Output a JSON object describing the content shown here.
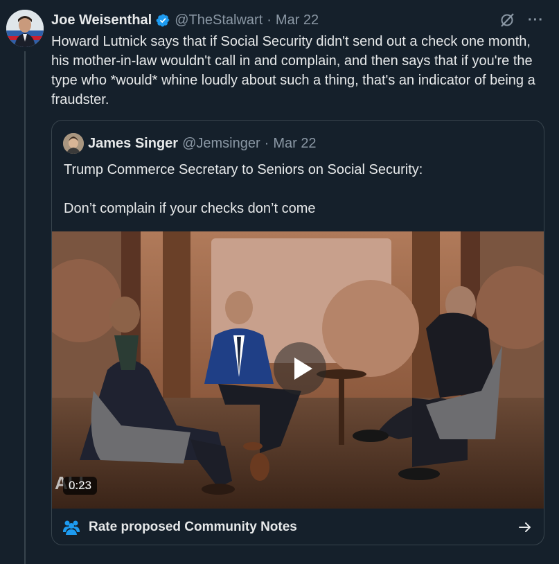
{
  "tweet": {
    "author_name": "Joe Weisenthal",
    "handle": "@TheStalwart",
    "separator": "·",
    "date": "Mar 22",
    "more_label": "···",
    "text": "Howard Lutnick says that if Social Security didn't send out a check one month, his mother-in-law wouldn't call in and complain, and then says that if you're the type who *would* whine loudly about such a thing, that's an indicator of being a fraudster."
  },
  "quote": {
    "author_name": "James Singer",
    "handle": "@Jemsinger",
    "separator": "·",
    "date": "Mar 22",
    "text_line1": "Trump Commerce Secretary to Seniors on Social Security:",
    "text_line2": "Don’t complain if your checks don’t come",
    "video": {
      "duration": "0:23"
    }
  },
  "community_notes": {
    "label": "Rate proposed Community Notes"
  },
  "colors": {
    "background": "#15202b",
    "text": "#e7e9ea",
    "muted": "#8b98a5",
    "border": "#38444d",
    "verified": "#1d9bf0",
    "notes_icon": "#1d9bf0"
  },
  "icons": {
    "verified": "verified-badge-icon",
    "grok": "grok-icon",
    "more": "more-icon",
    "play": "play-icon",
    "notes": "people-icon",
    "arrow": "arrow-right-icon"
  }
}
